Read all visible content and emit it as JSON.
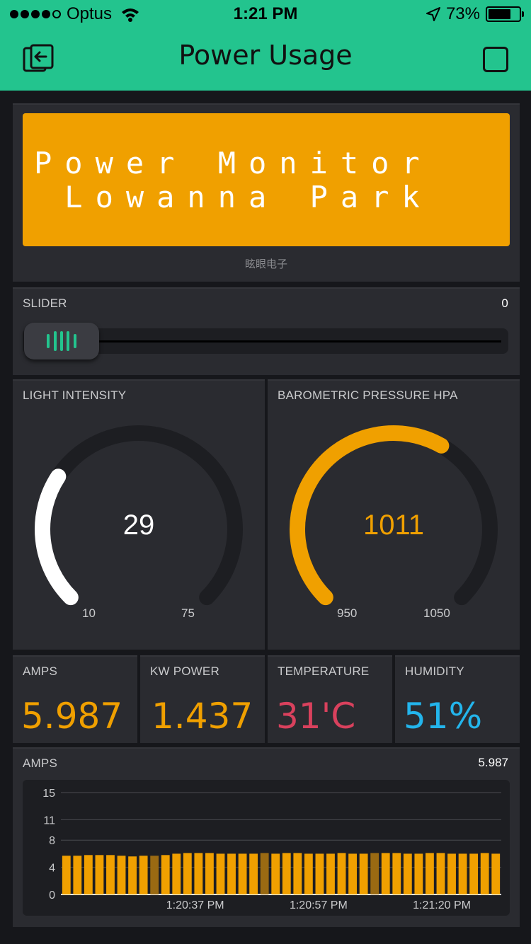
{
  "status_bar": {
    "carrier": "Optus",
    "time": "1:21 PM",
    "battery": "73%",
    "battery_level": 0.73
  },
  "nav": {
    "title": "Power Usage"
  },
  "lcd": {
    "line1": "Power Monitor",
    "line2": " Lowanna Park",
    "caption": "眩眼电子",
    "color": "#f0a000"
  },
  "slider": {
    "label": "SLIDER",
    "value": "0",
    "position": 0,
    "accent": "#23c48e"
  },
  "gauges": [
    {
      "label": "LIGHT INTENSITY",
      "value": "29",
      "min": "10",
      "max": "75",
      "color": "#ffffff",
      "fraction": 0.29
    },
    {
      "label": "BAROMETRIC PRESSURE HPA",
      "value": "1011",
      "min": "950",
      "max": "1050",
      "color": "#f0a000",
      "fraction": 0.61
    }
  ],
  "values": [
    {
      "label": "AMPS",
      "value": "5.987",
      "color": "#f0a000"
    },
    {
      "label": "KW POWER",
      "value": "1.437",
      "color": "#f0a000"
    },
    {
      "label": "TEMPERATURE",
      "value": "31'C",
      "color": "#d9415d"
    },
    {
      "label": "HUMIDITY",
      "value": "51%",
      "color": "#23b5ec"
    }
  ],
  "chart": {
    "label": "AMPS",
    "current": "5.987"
  },
  "chart_data": {
    "type": "bar",
    "color": "#f0a000",
    "y_ticks": [
      "15",
      "11",
      "8",
      "4",
      "0"
    ],
    "ylim": [
      0,
      15
    ],
    "x_tick_labels": [
      "1:20:37 PM",
      "1:20:57 PM",
      "1:21:20 PM"
    ],
    "values": [
      5.7,
      5.7,
      5.8,
      5.8,
      5.8,
      5.7,
      5.6,
      5.7,
      5.7,
      5.8,
      6.0,
      6.1,
      6.1,
      6.1,
      6.0,
      6.0,
      6.0,
      6.0,
      6.1,
      6.0,
      6.1,
      6.1,
      6.0,
      6.0,
      6.0,
      6.1,
      6.0,
      6.0,
      6.1,
      6.1,
      6.1,
      6.0,
      6.0,
      6.1,
      6.1,
      6.0,
      6.0,
      6.0,
      6.1,
      6.0
    ],
    "dimmed_indices": [
      8,
      18,
      28
    ]
  }
}
